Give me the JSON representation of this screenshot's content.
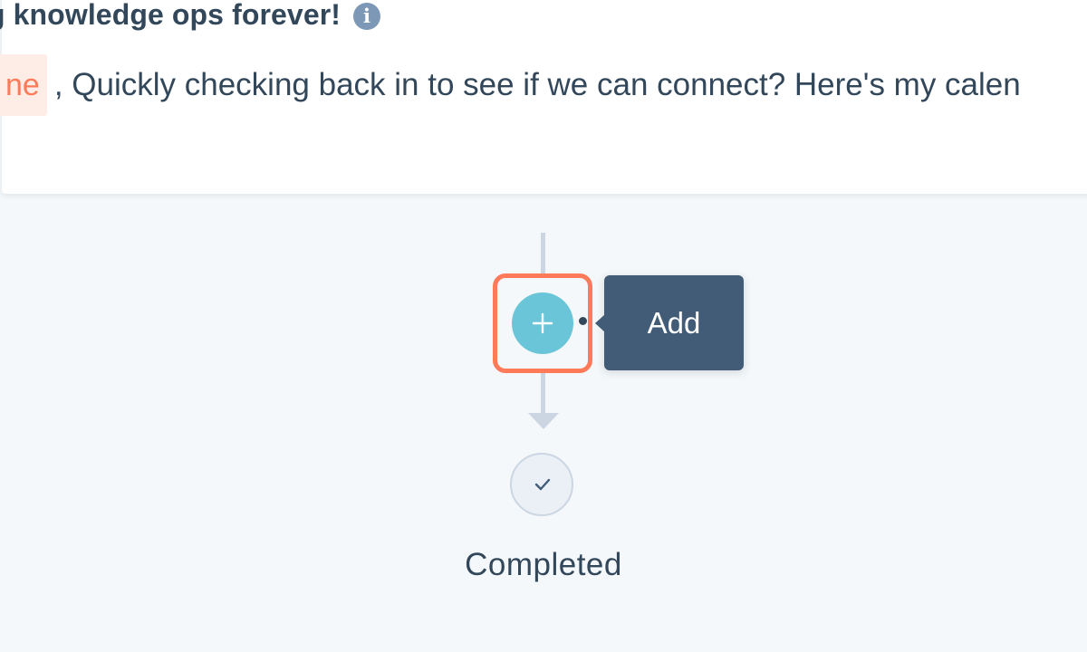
{
  "email": {
    "subject": "g knowledge ops forever!",
    "info_icon": "info-icon",
    "token_label": "ne",
    "body_text": ", Quickly checking back in to see if we can connect? Here's my calen"
  },
  "workflow": {
    "add_button_icon": "plus-icon",
    "tooltip_label": "Add",
    "completed_icon": "check-icon",
    "completed_label": "Completed"
  },
  "colors": {
    "highlight": "#ff7a59",
    "add_button": "#6ac5d8",
    "tooltip_bg": "#425b76",
    "text": "#33475b",
    "connector": "#cbd6e2",
    "canvas_bg": "#f5f8fa"
  }
}
